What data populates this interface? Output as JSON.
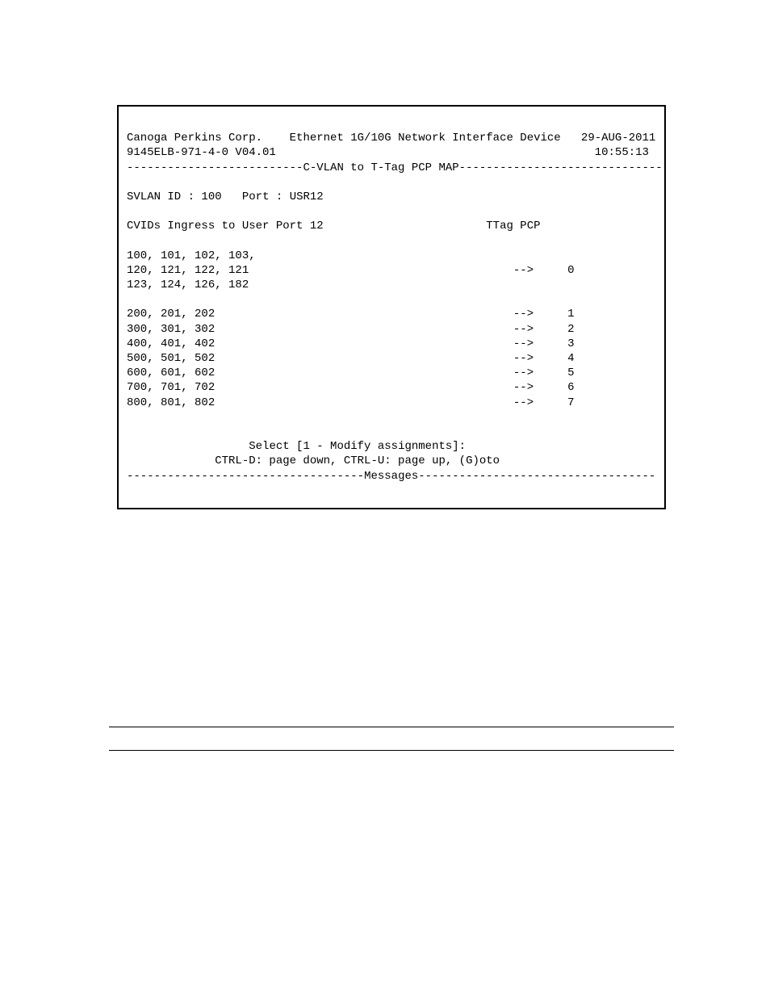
{
  "header": {
    "company": "Canoga Perkins Corp.",
    "device": "Ethernet 1G/10G Network Interface Device",
    "date": "29-AUG-2011",
    "model": "9145ELB-971-4-0 V04.01",
    "time": "10:55:13"
  },
  "section_title": "C-VLAN to T-Tag PCP MAP",
  "svlan_label": "SVLAN ID :",
  "svlan_id": "100",
  "port_label": "Port :",
  "port": "USR12",
  "cvids_header": "CVIDs Ingress to User Port 12",
  "ttag_header": "TTag PCP",
  "group0": {
    "line1": "100, 101, 102, 103,",
    "line2": "120, 121, 122, 121",
    "line3": "123, 124, 126, 182",
    "arrow": "-->",
    "pcp": "0"
  },
  "rows": [
    {
      "cvids": "200, 201, 202",
      "arrow": "-->",
      "pcp": "1"
    },
    {
      "cvids": "300, 301, 302",
      "arrow": "-->",
      "pcp": "2"
    },
    {
      "cvids": "400, 401, 402",
      "arrow": "-->",
      "pcp": "3"
    },
    {
      "cvids": "500, 501, 502",
      "arrow": "-->",
      "pcp": "4"
    },
    {
      "cvids": "600, 601, 602",
      "arrow": "-->",
      "pcp": "5"
    },
    {
      "cvids": "700, 701, 702",
      "arrow": "-->",
      "pcp": "6"
    },
    {
      "cvids": "800, 801, 802",
      "arrow": "-->",
      "pcp": "7"
    }
  ],
  "prompt": "Select [1 - Modify assignments]:",
  "nav": "CTRL-D: page down, CTRL-U: page up, (G)oto",
  "messages_title": "Messages"
}
